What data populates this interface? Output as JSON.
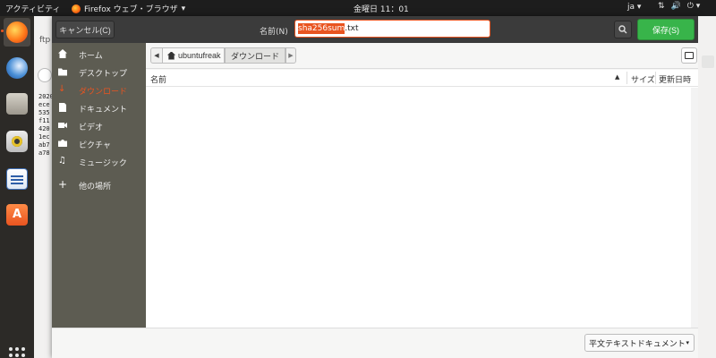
{
  "topbar": {
    "activities": "アクティビティ",
    "app_menu": "Firefox ウェブ・ブラウザ",
    "app_menu_caret": "▾",
    "clock": "金曜日 11：01",
    "lang": "ja ▾",
    "tray_icons": [
      "network-icon",
      "volume-icon",
      "power-icon"
    ],
    "tray_glyphs": [
      "⇅",
      "🔊",
      "⏻ ▾"
    ]
  },
  "dock": {
    "items": [
      "firefox-icon",
      "thunderbird-icon",
      "files-icon",
      "rhythmbox-icon",
      "writer-icon",
      "software-icon"
    ]
  },
  "background_window": {
    "tab_text": "ftp",
    "terminal_lines": "2020\nece\n535\nf11\n420\n1ec\nab7\na78"
  },
  "dialog": {
    "cancel_label": "キャンセル(C)",
    "name_label": "名前(N)",
    "filename_selected": "sha256sum",
    "filename_rest": ".txt",
    "save_label": "保存(S)",
    "accent_color": "#e95420",
    "save_color": "#38b44a"
  },
  "places": [
    {
      "label": "ホーム",
      "icon": "home-icon"
    },
    {
      "label": "デスクトップ",
      "icon": "desktop-icon"
    },
    {
      "label": "ダウンロード",
      "icon": "download-icon",
      "active": true
    },
    {
      "label": "ドキュメント",
      "icon": "document-icon"
    },
    {
      "label": "ビデオ",
      "icon": "video-icon"
    },
    {
      "label": "ピクチャ",
      "icon": "camera-icon"
    },
    {
      "label": "ミュージック",
      "icon": "music-icon"
    },
    {
      "label": "他の場所",
      "icon": "plus-icon"
    }
  ],
  "pathbar": {
    "left_arrow": "◀",
    "home_crumb": "ubuntufreak",
    "current_crumb": "ダウンロード",
    "right_arrow": "▶"
  },
  "filelist": {
    "columns": {
      "name": "名前",
      "size": "サイズ",
      "modified": "更新日時"
    },
    "sort_indicator": "▲",
    "rows": []
  },
  "filter": {
    "selected": "平文テキストドキュメント",
    "caret": "▾"
  }
}
